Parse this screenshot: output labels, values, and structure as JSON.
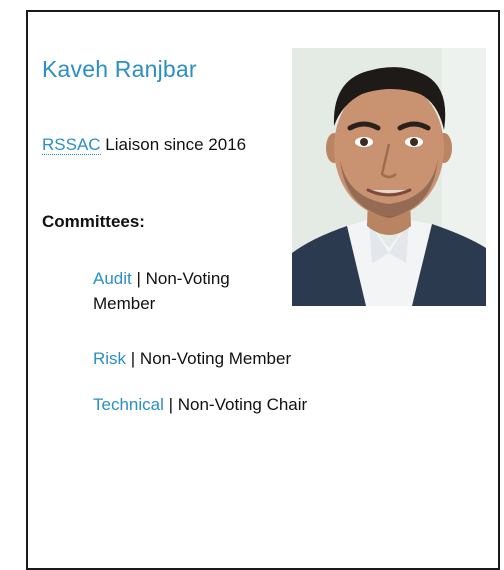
{
  "person": {
    "name": "Kaveh Ranjbar",
    "role_link": "RSSAC",
    "role_text": " Liaison since 2016"
  },
  "committees_heading": "Committees:",
  "committees": [
    {
      "name": "Audit",
      "role": " | Non-Voting Member"
    },
    {
      "name": "Risk",
      "role": " | Non-Voting Member"
    },
    {
      "name": "Technical",
      "role": " | Non-Voting Chair"
    }
  ],
  "colors": {
    "link": "#2a8fc4",
    "border": "#1a1a1a"
  },
  "photo": {
    "icon": "portrait-photo"
  }
}
